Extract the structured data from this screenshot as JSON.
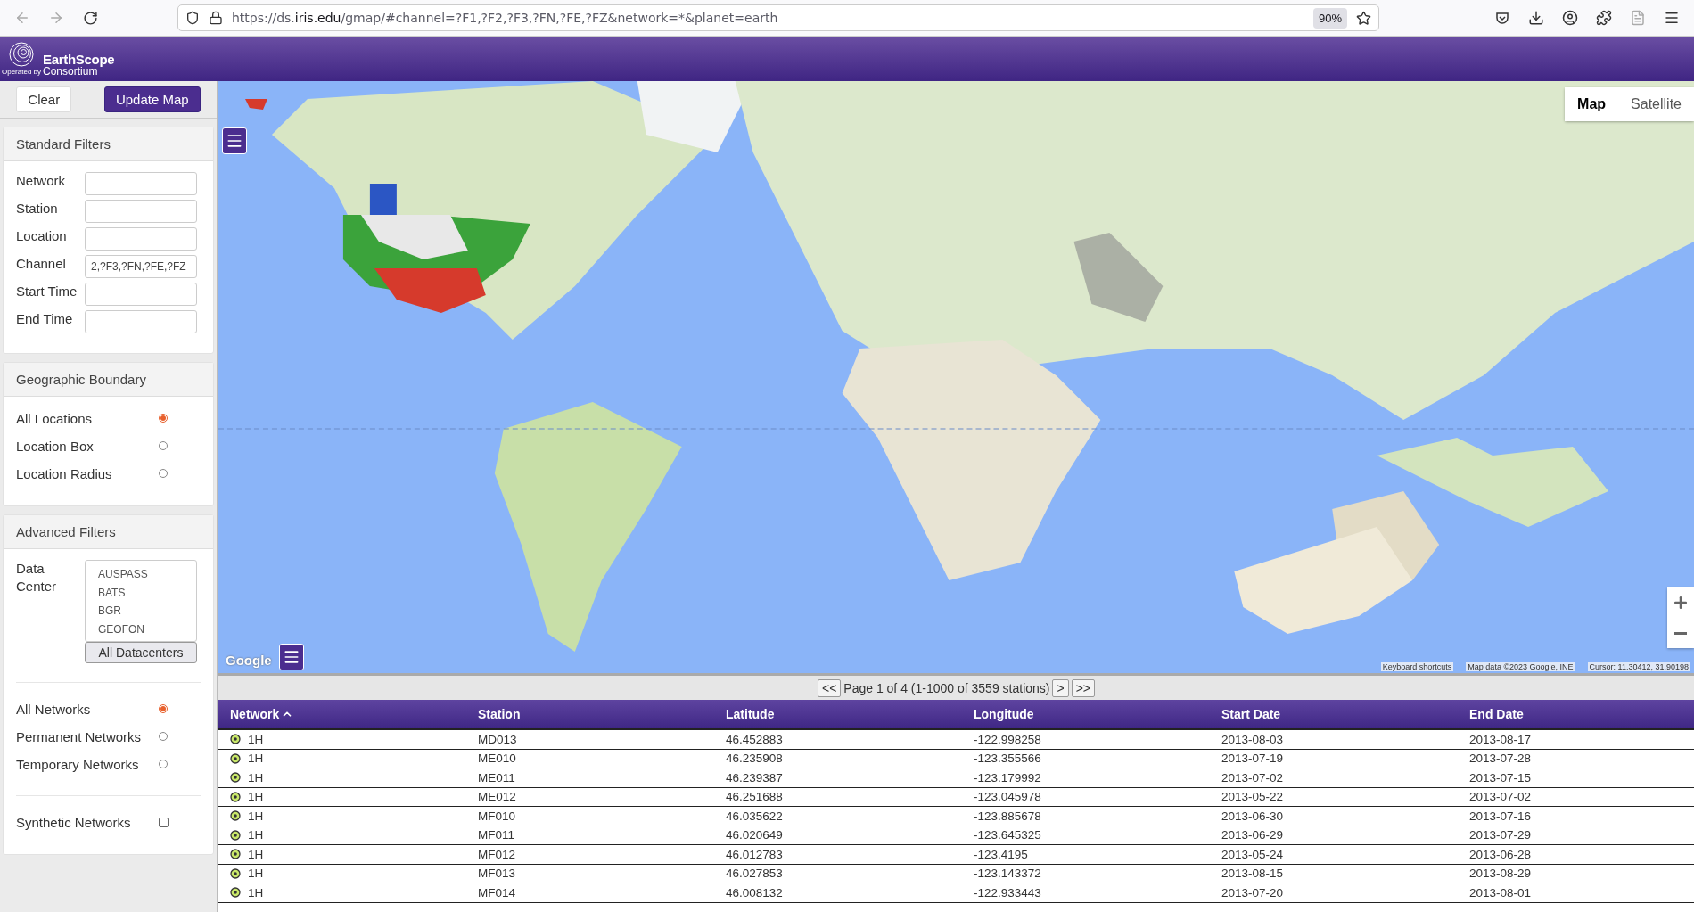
{
  "browser": {
    "url": {
      "prefix": "https://ds.",
      "domain": "iris.edu",
      "path": "/gmap/#channel=?F1,?F2,?F3,?FN,?FE,?FZ&network=*&planet=earth"
    },
    "zoom": "90%"
  },
  "header": {
    "operated_by": "Operated by",
    "brand": "EarthScope",
    "brand_sub": "Consortium"
  },
  "sidebar": {
    "actions": [
      {
        "label": "Clear",
        "kind": "plain"
      },
      {
        "label": "Update Map",
        "kind": "primary"
      }
    ],
    "standard_filters": {
      "title": "Standard Filters",
      "fields": [
        {
          "label": "Network"
        },
        {
          "label": "Station"
        },
        {
          "label": "Location"
        },
        {
          "label": "Channel",
          "value": "2,?F3,?FN,?FE,?FZ"
        },
        {
          "label": "Start Time"
        },
        {
          "label": "End Time"
        }
      ]
    },
    "geographic_boundary": {
      "title": "Geographic Boundary",
      "options": [
        {
          "label": "All Locations",
          "selected": true
        },
        {
          "label": "Location Box",
          "selected": false
        },
        {
          "label": "Location Radius",
          "selected": false
        }
      ]
    },
    "advanced_filters": {
      "title": "Advanced Filters",
      "data_center": {
        "label": "Data Center",
        "items": [
          "AUSPASS",
          "BATS",
          "BGR",
          "GEOFON"
        ],
        "button": "All Datacenters"
      },
      "network_types": [
        {
          "label": "All Networks",
          "selected": true
        },
        {
          "label": "Permanent Networks",
          "selected": false
        },
        {
          "label": "Temporary Networks",
          "selected": false
        }
      ],
      "synthetic": {
        "label": "Synthetic Networks",
        "checked": false
      }
    }
  },
  "map": {
    "kind": "picture",
    "view_toggle": [
      {
        "label": "Map",
        "selected": true
      },
      {
        "label": "Satellite",
        "selected": false
      }
    ],
    "logo_text": "Google",
    "attribution": [
      "Keyboard shortcuts",
      "Map data ©2023 Google, INE",
      "Cursor: 11.30412, 31.90198"
    ]
  },
  "pager": {
    "first": "<<",
    "info": "Page 1 of 4 (1-1000 of 3559 stations)",
    "next": ">",
    "last": ">>"
  },
  "table": {
    "columns": [
      {
        "label": "Network",
        "sorted": true
      },
      {
        "label": "Station",
        "sorted": false
      },
      {
        "label": "Latitude",
        "sorted": false
      },
      {
        "label": "Longitude",
        "sorted": false
      },
      {
        "label": "Start Date",
        "sorted": false
      },
      {
        "label": "End Date",
        "sorted": false
      }
    ],
    "rows": [
      [
        "1H",
        "MD013",
        "46.452883",
        "-122.998258",
        "2013-08-03",
        "2013-08-17"
      ],
      [
        "1H",
        "ME010",
        "46.235908",
        "-123.355566",
        "2013-07-19",
        "2013-07-28"
      ],
      [
        "1H",
        "ME011",
        "46.239387",
        "-123.179992",
        "2013-07-02",
        "2013-07-15"
      ],
      [
        "1H",
        "ME012",
        "46.251688",
        "-123.045978",
        "2013-05-22",
        "2013-07-02"
      ],
      [
        "1H",
        "MF010",
        "46.035622",
        "-123.885678",
        "2013-06-30",
        "2013-07-16"
      ],
      [
        "1H",
        "MF011",
        "46.020649",
        "-123.645325",
        "2013-06-29",
        "2013-07-29"
      ],
      [
        "1H",
        "MF012",
        "46.012783",
        "-123.4195",
        "2013-05-24",
        "2013-06-28"
      ],
      [
        "1H",
        "MF013",
        "46.027853",
        "-123.143372",
        "2013-08-15",
        "2013-08-29"
      ],
      [
        "1H",
        "MF014",
        "46.008132",
        "-122.933443",
        "2013-07-20",
        "2013-08-01"
      ]
    ]
  }
}
